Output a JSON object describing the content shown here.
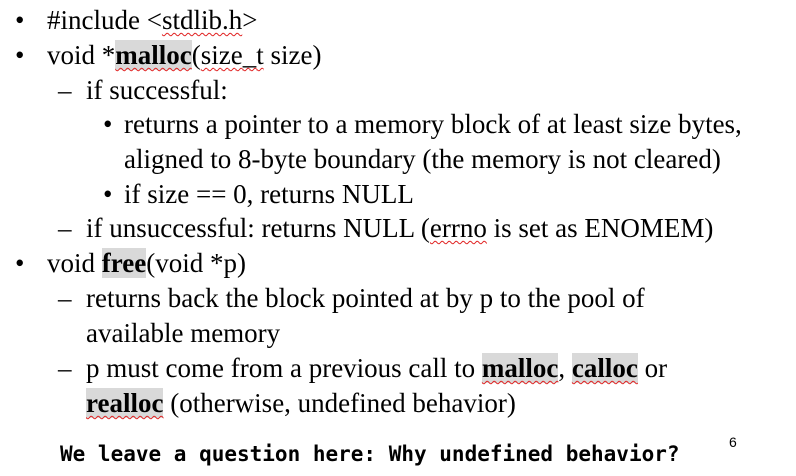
{
  "glyphs": {
    "bullet": "•",
    "dash": "–"
  },
  "slide": {
    "line1": {
      "text_prefix": "#include <",
      "stdlib": "stdlib.h",
      "text_suffix": ">"
    },
    "line2": {
      "pre": "void *",
      "malloc": "malloc",
      "open": "(",
      "size_t": "size_t",
      "post": " size)"
    },
    "line3": "if successful:",
    "line4": "returns a pointer to a memory block of at least size bytes,",
    "line5": "aligned to 8-byte boundary (the memory is not cleared)",
    "line6": "if size == 0, returns NULL",
    "line7": {
      "pre": "if unsuccessful: returns NULL (",
      "errno": "errno",
      "post": " is set as ENOMEM)"
    },
    "line8": {
      "pre": "void ",
      "free": "free",
      "post": "(void *p)"
    },
    "line9": "returns back the block pointed at by p to the pool of",
    "line10": "available memory",
    "line11": {
      "pre": "p must come from a previous call to ",
      "malloc": "malloc",
      "comma": ", ",
      "calloc": "calloc",
      "post": " or"
    },
    "line12": {
      "realloc": "realloc",
      "post": " (otherwise, undefined behavior)"
    },
    "question": "We leave a question here: Why undefined behavior?",
    "page_number": "6"
  }
}
